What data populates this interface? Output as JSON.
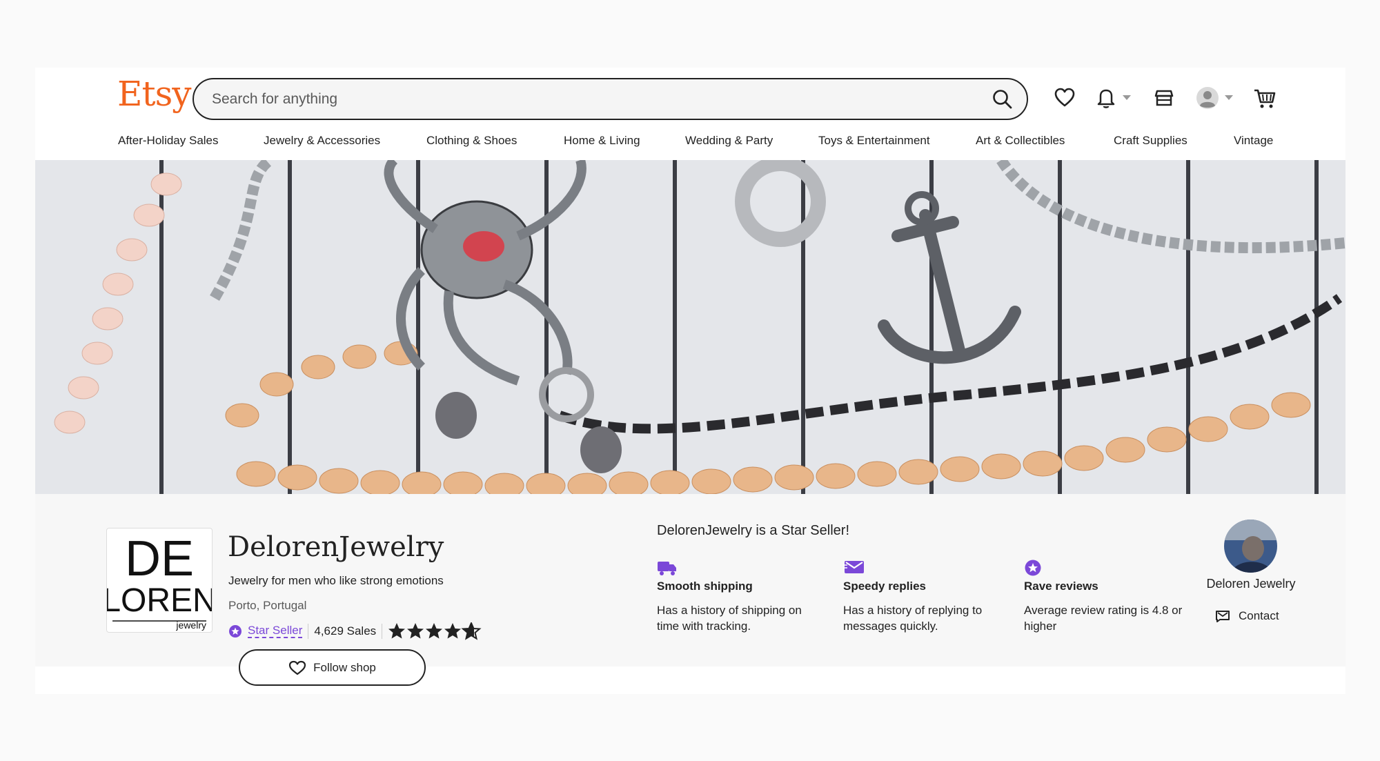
{
  "header": {
    "logo_text": "Etsy",
    "search_placeholder": "Search for anything",
    "icons": [
      "heart-icon",
      "bell-icon",
      "shop-icon",
      "account-avatar-icon",
      "cart-icon"
    ]
  },
  "nav": {
    "items": [
      "After-Holiday Sales",
      "Jewelry & Accessories",
      "Clothing & Shoes",
      "Home & Living",
      "Wedding & Party",
      "Toys & Entertainment",
      "Art & Collectibles",
      "Craft Supplies",
      "Vintage"
    ]
  },
  "shop": {
    "logo_text_1": "DE",
    "logo_text_2": "LOREN",
    "logo_text_3": "jewelry",
    "name": "DelorenJewelry",
    "tagline": "Jewelry for men who like strong emotions",
    "location": "Porto, Portugal",
    "star_seller_label": "Star Seller",
    "sales": "4,629 Sales",
    "rating_stars": 4.5,
    "follow_label": "Follow shop"
  },
  "star_seller": {
    "heading": "DelorenJewelry is a Star Seller!",
    "features": [
      {
        "icon": "truck-icon",
        "title": "Smooth shipping",
        "text": "Has a history of shipping on time with tracking."
      },
      {
        "icon": "message-icon",
        "title": "Speedy replies",
        "text": "Has a history of replying to messages quickly."
      },
      {
        "icon": "star-badge-icon",
        "title": "Rave reviews",
        "text": "Average review rating is 4.8 or higher"
      }
    ]
  },
  "owner": {
    "name": "Deloren Jewelry",
    "contact_label": "Contact"
  },
  "colors": {
    "brand": "#f1641e",
    "star_seller": "#7b48d8",
    "text": "#222222"
  }
}
